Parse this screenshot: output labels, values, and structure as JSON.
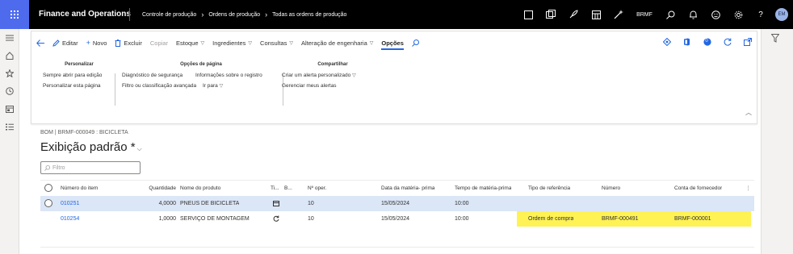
{
  "topbar": {
    "app_name": "Finance and Operations",
    "breadcrumbs": [
      "Controle de produção",
      "Ordens de produção",
      "Todas as ordens de produção"
    ],
    "company": "BRMF",
    "avatar_initials": "EM"
  },
  "action_pane": {
    "items": {
      "edit": "Editar",
      "new": "Novo",
      "delete": "Excluir",
      "copy": "Copiar",
      "stock": "Estoque",
      "ingredients": "Ingredientes",
      "queries": "Consultas",
      "eng_change": "Alteração de engenharia",
      "options": "Opções"
    },
    "notification_count": "0",
    "groups": {
      "personalize": {
        "title": "Personalizar",
        "items": [
          "Sempre abrir para edição",
          "Personalizar esta página"
        ]
      },
      "page_options": {
        "title": "Opções de página",
        "items": [
          "Diagnóstico de segurança",
          "Informações sobre o registro",
          "Filtro ou classificação avançada",
          "Ir para"
        ]
      },
      "share": {
        "title": "Compartilhar",
        "items": [
          "Criar um alerta personalizado",
          "Gerenciar meus alertas"
        ]
      }
    }
  },
  "page": {
    "subtitle": "BOM | BRMF-000049 : BICICLETA",
    "title": "Exibição padrão *",
    "filter_placeholder": "Filtro"
  },
  "grid": {
    "columns": [
      "Número do item",
      "Quantidade",
      "Nome do produto",
      "Ti...",
      "B...",
      "Nº oper.",
      "Data da matéria- prima",
      "Tempo de matéria-prima",
      "Tipo de referência",
      "Número",
      "Conta de fornecedor"
    ],
    "rows": [
      {
        "item": "010251",
        "qty": "4,0000",
        "name": "PNEUS DE BICICLETA",
        "icon": "box-icon",
        "op": "10",
        "date": "15/05/2024",
        "time": "10:00",
        "ref_type": "",
        "number": "",
        "vendor": ""
      },
      {
        "item": "010254",
        "qty": "1,0000",
        "name": "SERVIÇO DE MONTAGEM",
        "icon": "cycle-icon",
        "op": "10",
        "date": "15/05/2024",
        "time": "10:00",
        "ref_type": "Ordem de compra",
        "number": "BRMF-000491",
        "vendor": "BRMF-000001"
      }
    ]
  },
  "colors": {
    "accent": "#2266e3",
    "waffle": "#4f6bed",
    "selected_row": "#dbe6f7",
    "highlight": "#fef255"
  }
}
